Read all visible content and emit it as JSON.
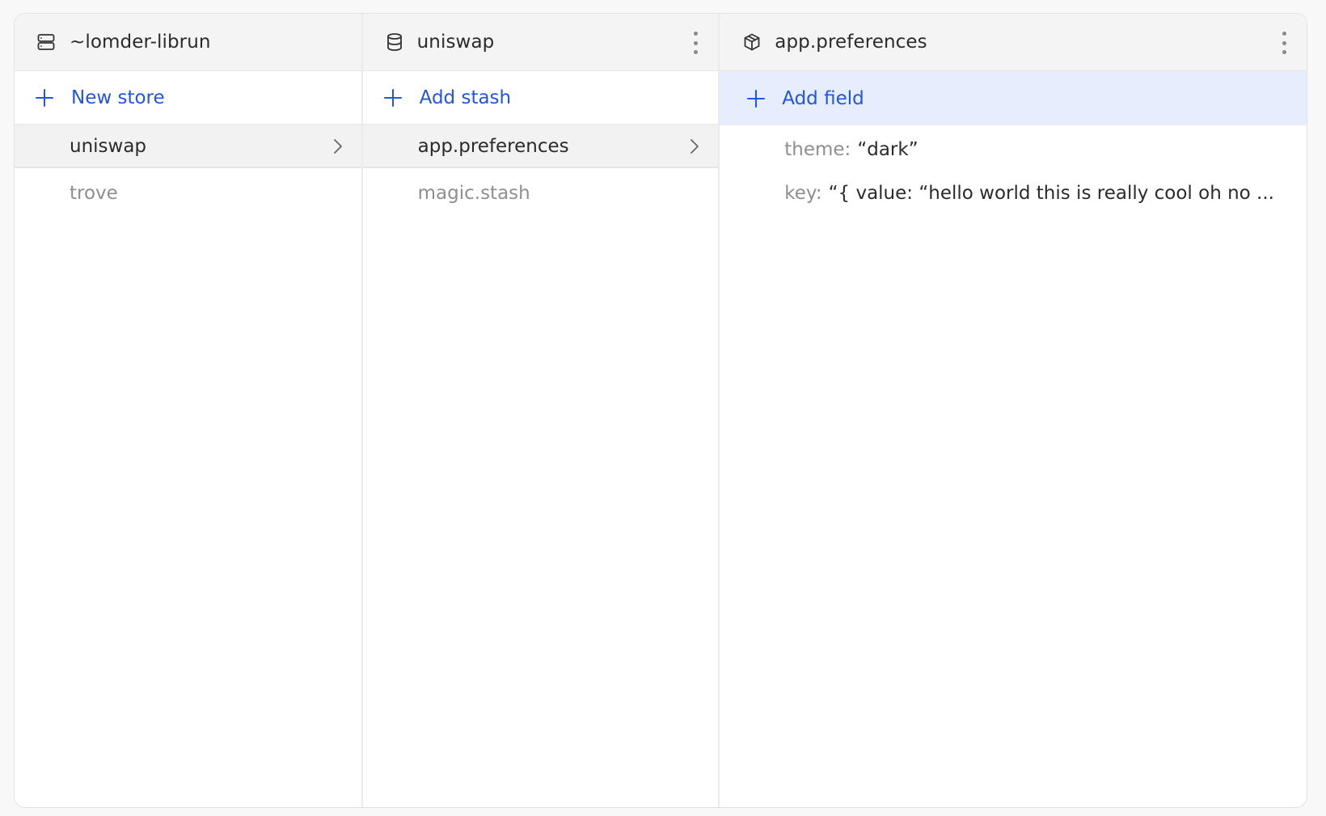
{
  "columns": {
    "server": {
      "title": "~lomder-librun",
      "icon": "server-icon",
      "add_label": "New store",
      "items": [
        {
          "label": "uniswap",
          "selected": true
        },
        {
          "label": "trove",
          "selected": false
        }
      ]
    },
    "store": {
      "title": "uniswap",
      "icon": "database-icon",
      "add_label": "Add stash",
      "items": [
        {
          "label": "app.preferences",
          "selected": true
        },
        {
          "label": "magic.stash",
          "selected": false
        }
      ]
    },
    "stash": {
      "title": "app.preferences",
      "icon": "package-icon",
      "add_label": "Add field",
      "fields": [
        {
          "key": "theme:",
          "value": "“dark”"
        },
        {
          "key": "key:",
          "value": "“{ value: “hello world this is really cool oh no ..."
        }
      ]
    }
  },
  "colors": {
    "accent": "#2155e8",
    "selected_bg": "#f2f2f2",
    "add_field_bg": "#e6edfc",
    "muted_text": "#8f8f8f"
  }
}
